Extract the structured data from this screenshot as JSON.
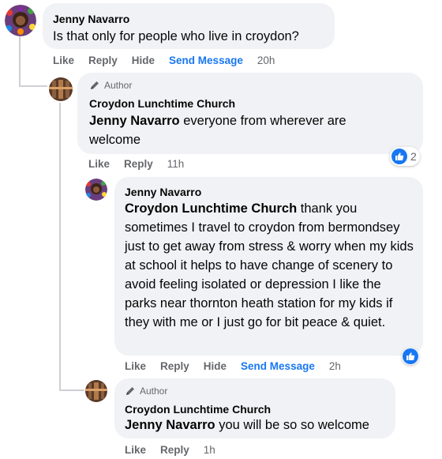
{
  "comments": [
    {
      "author": "Jenny Navarro",
      "text": "Is that only for people who live in croydon?",
      "actions": {
        "like": "Like",
        "reply": "Reply",
        "hide": "Hide",
        "send_message": "Send Message",
        "time": "20h"
      }
    },
    {
      "badge": "Author",
      "author": "Croydon Lunchtime Church",
      "mention": "Jenny Navarro",
      "text": " everyone from wherever are welcome",
      "reaction_count": "2",
      "actions": {
        "like": "Like",
        "reply": "Reply",
        "time": "11h"
      }
    },
    {
      "author": "Jenny Navarro",
      "mention": "Croydon Lunchtime Church",
      "text": " thank you sometimes I travel to croydon from bermondsey just to get away from stress & worry when my kids at school it helps to have change of scenery to avoid feeling isolated or depression I like the parks near thornton heath station for my kids if they with me or I just go for bit peace & quiet.",
      "actions": {
        "like": "Like",
        "reply": "Reply",
        "hide": "Hide",
        "send_message": "Send Message",
        "time": "2h"
      }
    },
    {
      "badge": "Author",
      "author": "Croydon Lunchtime Church",
      "mention": "Jenny Navarro",
      "text": " you will be so so welcome",
      "actions": {
        "like": "Like",
        "reply": "Reply",
        "time": "1h"
      }
    }
  ],
  "colors": {
    "bubble": "#f0f2f5",
    "link": "#1877f2",
    "muted": "#65676b",
    "thread_line": "#ced0d4"
  },
  "icons": {
    "reaction": "like-icon",
    "author_badge": "pencil-icon"
  }
}
